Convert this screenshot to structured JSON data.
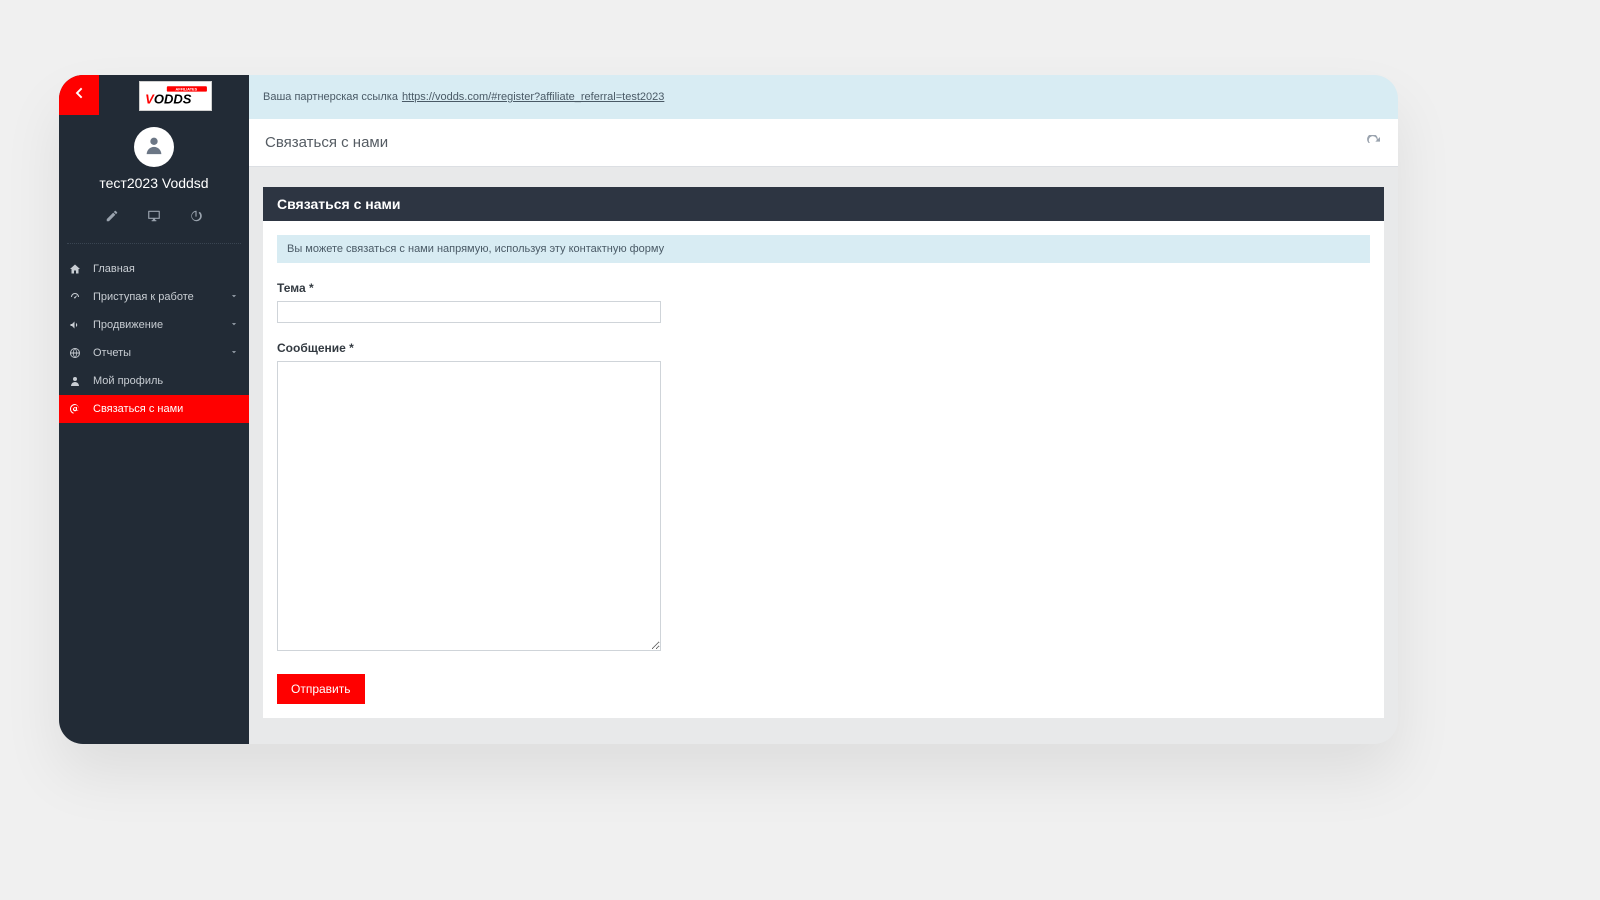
{
  "colors": {
    "accent": "#ff0000",
    "sidebar_bg": "#222b36",
    "info_bg": "#d8ecf3"
  },
  "logo": {
    "text_main": "VODDS",
    "text_badge": "AFFILIATES"
  },
  "user": {
    "display_name": "тест2023 Voddsd"
  },
  "nav": {
    "items": [
      {
        "icon": "home",
        "label": "Главная",
        "expandable": false,
        "active": false
      },
      {
        "icon": "gauge",
        "label": "Приступая к работе",
        "expandable": true,
        "active": false
      },
      {
        "icon": "bullhorn",
        "label": "Продвижение",
        "expandable": true,
        "active": false
      },
      {
        "icon": "globe",
        "label": "Отчеты",
        "expandable": true,
        "active": false
      },
      {
        "icon": "user",
        "label": "Мой профиль",
        "expandable": false,
        "active": false
      },
      {
        "icon": "at",
        "label": "Связаться с нами",
        "expandable": false,
        "active": true
      }
    ]
  },
  "referral": {
    "prefix": "Ваша партнерская ссылка",
    "url": "https://vodds.com/#register?affiliate_referral=test2023"
  },
  "page": {
    "breadcrumb": "Связаться с нами",
    "card_title": "Связаться с нами",
    "info_text": "Вы можете связаться с нами напрямую, используя эту контактную форму",
    "form": {
      "subject_label": "Тема *",
      "subject_value": "",
      "message_label": "Сообщение *",
      "message_value": "",
      "submit_label": "Отправить"
    }
  }
}
